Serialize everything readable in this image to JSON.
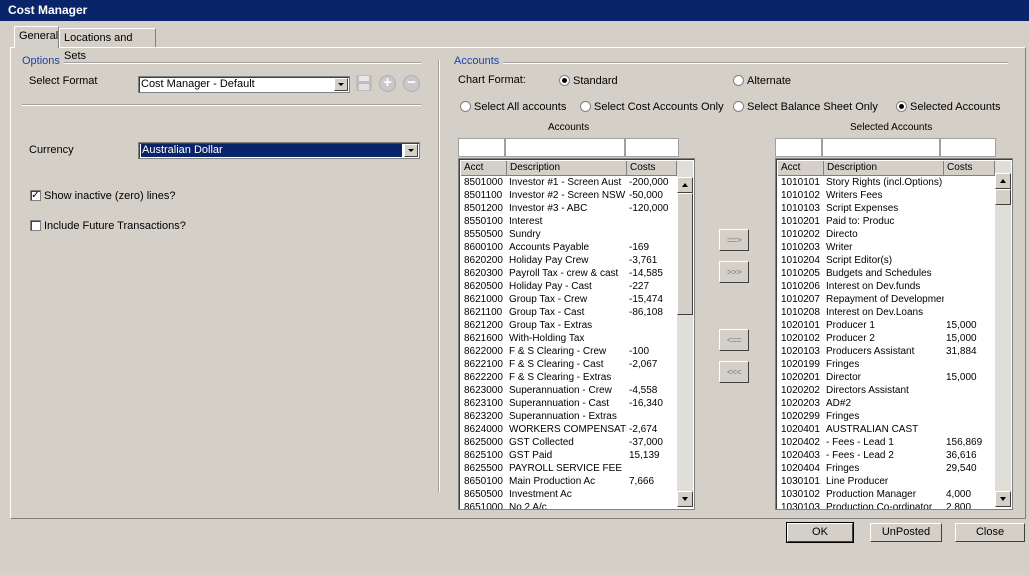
{
  "window": {
    "title": "Cost Manager"
  },
  "tabs": [
    {
      "label": "General"
    },
    {
      "label": "Locations and Sets"
    }
  ],
  "options": {
    "group_title": "Options",
    "select_format_label": "Select Format",
    "select_format_value": "Cost Manager - Default",
    "currency_label": "Currency",
    "currency_value": "Australian Dollar",
    "show_inactive_label": "Show inactive (zero) lines?",
    "show_inactive_checked": true,
    "include_future_label": "Include Future Transactions?",
    "include_future_checked": false,
    "icons": [
      "save-icon",
      "add-icon",
      "remove-icon"
    ]
  },
  "accounts": {
    "group_title": "Accounts",
    "chart_format_label": "Chart Format:",
    "chart_format_options": [
      {
        "label": "Standard",
        "selected": true
      },
      {
        "label": "Alternate",
        "selected": false
      }
    ],
    "filter_options": [
      {
        "label": "Select All accounts",
        "selected": false
      },
      {
        "label": "Select Cost Accounts Only",
        "selected": false
      },
      {
        "label": "Select Balance Sheet Only",
        "selected": false
      },
      {
        "label": "Selected Accounts",
        "selected": true
      }
    ],
    "accounts_list_title": "Accounts",
    "selected_list_title": "Selected Accounts",
    "columns": [
      "Acct",
      "Description",
      "Costs"
    ],
    "accounts_rows": [
      [
        "8501000",
        "Investor #1 - Screen Aust",
        "-200,000"
      ],
      [
        "8501100",
        "Investor #2 - Screen NSW",
        "-50,000"
      ],
      [
        "8501200",
        "Investor #3 - ABC",
        "-120,000"
      ],
      [
        "8550100",
        "Interest",
        ""
      ],
      [
        "8550500",
        "Sundry",
        ""
      ],
      [
        "8600100",
        "Accounts Payable",
        "-169"
      ],
      [
        "8620200",
        "Holiday Pay Crew",
        "-3,761"
      ],
      [
        "8620300",
        "Payroll Tax - crew & cast",
        "-14,585"
      ],
      [
        "8620500",
        "Holiday Pay - Cast",
        "-227"
      ],
      [
        "8621000",
        "Group Tax - Crew",
        "-15,474"
      ],
      [
        "8621100",
        "Group Tax - Cast",
        "-86,108"
      ],
      [
        "8621200",
        "Group Tax - Extras",
        ""
      ],
      [
        "8621600",
        "With-Holding Tax",
        ""
      ],
      [
        "8622000",
        "F & S Clearing - Crew",
        "-100"
      ],
      [
        "8622100",
        "F & S Clearing - Cast",
        "-2,067"
      ],
      [
        "8622200",
        "F & S Clearing - Extras",
        ""
      ],
      [
        "8623000",
        "Superannuation - Crew",
        "-4,558"
      ],
      [
        "8623100",
        "Superannuation - Cast",
        "-16,340"
      ],
      [
        "8623200",
        "Superannuation - Extras",
        ""
      ],
      [
        "8624000",
        "WORKERS COMPENSATIO",
        "-2,674"
      ],
      [
        "8625000",
        "GST Collected",
        "-37,000"
      ],
      [
        "8625100",
        "GST Paid",
        "15,139"
      ],
      [
        "8625500",
        "PAYROLL SERVICE FEE",
        ""
      ],
      [
        "8650100",
        "Main Production Ac",
        "7,666"
      ],
      [
        "8650500",
        "Investment Ac",
        ""
      ],
      [
        "8651000",
        "No 2 A/c",
        ""
      ]
    ],
    "selected_rows": [
      [
        "1010101",
        "Story Rights (incl.Options)",
        ""
      ],
      [
        "1010102",
        "Writers Fees",
        ""
      ],
      [
        "1010103",
        "Script Expenses",
        ""
      ],
      [
        "1010201",
        "Paid to:                Produc",
        ""
      ],
      [
        "1010202",
        "                               Directo",
        ""
      ],
      [
        "1010203",
        "                               Writer",
        ""
      ],
      [
        "1010204",
        "Script Editor(s)",
        ""
      ],
      [
        "1010205",
        "Budgets and Schedules",
        ""
      ],
      [
        "1010206",
        "Interest on Dev.funds",
        ""
      ],
      [
        "1010207",
        "Repayment of Development",
        ""
      ],
      [
        "1010208",
        "Interest on Dev.Loans",
        ""
      ],
      [
        "1020101",
        "Producer 1",
        "15,000"
      ],
      [
        "1020102",
        "Producer 2",
        "15,000"
      ],
      [
        "1020103",
        "Producers Assistant",
        "31,884"
      ],
      [
        "1020199",
        "Fringes",
        ""
      ],
      [
        "1020201",
        "Director",
        "15,000"
      ],
      [
        "1020202",
        "Directors Assistant",
        ""
      ],
      [
        "1020203",
        "AD#2",
        ""
      ],
      [
        "1020299",
        "Fringes",
        ""
      ],
      [
        "1020401",
        "   AUSTRALIAN CAST",
        ""
      ],
      [
        "1020402",
        " - Fees - Lead 1",
        "156,869"
      ],
      [
        "1020403",
        " - Fees - Lead 2",
        "36,616"
      ],
      [
        "1020404",
        "Fringes",
        "29,540"
      ],
      [
        "1030101",
        "Line Producer",
        ""
      ],
      [
        "1030102",
        "Production Manager",
        "4,000"
      ],
      [
        "1030103",
        "Production Co-ordinator",
        "2,800"
      ]
    ],
    "move_buttons": [
      {
        "label": "==>"
      },
      {
        "label": ">>>"
      },
      {
        "label": "<=="
      },
      {
        "label": "<<<"
      }
    ]
  },
  "footer_buttons": {
    "ok": "OK",
    "unposted": "UnPosted",
    "close": "Close"
  }
}
